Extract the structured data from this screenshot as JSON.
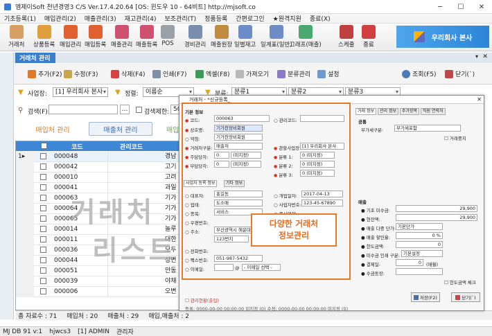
{
  "window": {
    "title": "엠제이Soft 천년경영3 C/S  Ver.17.4.20.64   [OS: 윈도우 10 - 64비트]   http://mjsoft.co"
  },
  "menu": [
    "기초등록(1)",
    "매입관리(2)",
    "매출관리(3)",
    "재고관리(4)",
    "보조관리(T)",
    "정품등록",
    "간편로그인",
    "★원격지원",
    "종료(X)"
  ],
  "toolbar": [
    {
      "label": "거래처",
      "color": "#d9a066"
    },
    {
      "label": "상품등록",
      "color": "#e0a040"
    },
    {
      "label": "매입관리",
      "color": "#e06030"
    },
    {
      "label": "매입등록",
      "color": "#e06030"
    },
    {
      "label": "매출관리",
      "color": "#d05070"
    },
    {
      "label": "매출등록",
      "color": "#d05070"
    },
    {
      "label": "POS",
      "color": "#9aa0a8"
    },
    {
      "label": "경비관리",
      "color": "#7a8fb0"
    },
    {
      "label": "매출원장",
      "color": "#c08a40"
    },
    {
      "label": "일별재고",
      "color": "#6d8cc8"
    },
    {
      "label": "일계표(일반)",
      "color": "#6d8cc8"
    },
    {
      "label": "그래프(매출)",
      "color": "#4aa870"
    },
    {
      "label": "스케줄",
      "color": "#c04040"
    },
    {
      "label": "종료",
      "color": "#d04040"
    }
  ],
  "brand": {
    "label": "우리회사 본사"
  },
  "doc_tab": {
    "label": "거래처 관리"
  },
  "subtoolbar": {
    "add": "추가(F2)",
    "edit": "수정(F3)",
    "delete": "삭제(F4)",
    "print": "인쇄(F7)",
    "excel": "엑셀(F8)",
    "import": "가져오기",
    "category": "분류관리",
    "settings": "설정",
    "search": "조회(F5)",
    "close": "닫기(`)"
  },
  "filters": {
    "branch_label": "사업장:",
    "branch_value": "[1] 우리회사 본사",
    "sort_label": "정렬:",
    "sort_value": "이름순",
    "cat_label": "분류:",
    "cat1": "분류1",
    "cat2": "분류2",
    "cat3": "분류3",
    "search_label": "검색(F):",
    "search_limit_label": "검색제한:",
    "search_limit_value": "50"
  },
  "modes": {
    "purchase": "매입처 관리",
    "sales": "매출처 관리",
    "third": "매입"
  },
  "grid": {
    "headers": {
      "code": "코드",
      "mgmt": "관리코드"
    },
    "rows": [
      {
        "code": "000048",
        "name": "경남"
      },
      {
        "code": "000042",
        "name": "고기"
      },
      {
        "code": "000010",
        "name": "고려"
      },
      {
        "code": "000041",
        "name": "과일"
      },
      {
        "code": "000063",
        "name": "기가"
      },
      {
        "code": "000064",
        "name": "기가"
      },
      {
        "code": "000065",
        "name": "기가"
      },
      {
        "code": "000014",
        "name": "놀루"
      },
      {
        "code": "000011",
        "name": "대한"
      },
      {
        "code": "000036",
        "name": "모두"
      },
      {
        "code": "000044",
        "name": "상변"
      },
      {
        "code": "000051",
        "name": "안동"
      },
      {
        "code": "000039",
        "name": "야채"
      },
      {
        "code": "000006",
        "name": "오변"
      }
    ],
    "first_marker": "1▸",
    "watermark_line1": "거래처",
    "watermark_line2": "리스트"
  },
  "status": {
    "total": "총 자료수 : 71",
    "purchase": "매입처 : 20",
    "sales": "매출처 : 29",
    "both": "매입,매출처 : 2"
  },
  "bottom_status": {
    "db": "MJ DB 91 v:1",
    "user": "hjwcs3",
    "role": "[1] ADMIN",
    "grade": "관리자"
  },
  "dialog": {
    "title": "거래처 - *신규등록_",
    "basic_section": "기본 정보",
    "code_label": "코드:",
    "code_value": "000063",
    "mgmt_label": "관리코드:",
    "name_label": "상호명:",
    "name_value": "기가찬장비회원",
    "alias_label": "약칭:",
    "alias_value": "기가찬장비회원",
    "type_label": "거래처구분:",
    "type_value": "매출처",
    "branch_label": "관할사업장:",
    "branch_value": "[1] 우리회사 본사",
    "major_label": "주담당자:",
    "major_value": "0",
    "major_unit": "(미지정)",
    "minor_label": "부담당자:",
    "minor_value": "0",
    "minor_unit": "(미지정)",
    "c1_label": "분류 1:",
    "c2_label": "분류 2:",
    "c3_label": "분류 3:",
    "c_value": "0",
    "c_unit": "(미지정)",
    "tabs": [
      "사업자 등록 정보",
      "기타 정보"
    ],
    "rep_label": "대표자:",
    "rep_value": "홍길동",
    "open_label": "개업일자:",
    "open_value": "2017-04-13",
    "biz_label": "업태:",
    "biz_value": "도소매",
    "bizno_label": "사업자번호:",
    "bizno_value": "123-45-67890",
    "item_label": "종목:",
    "item_value": "서비스",
    "sub_label": "종사업장:",
    "zip_label": "우편번호:",
    "addr_label": "주소:",
    "addr_value": "부산광역시 해운대구",
    "addr2_value": "123번지",
    "tel_label": "전화번호:",
    "fax_label": "팩스번호:",
    "fax_value": "051-987-5432",
    "email_label": "이메일:",
    "email_domain": "- 이메일 선택 -",
    "bond_label": "관리현황(출입)",
    "footer": "등록: 0000-00-00 00:00:00   미지정 (0)   수정: 0000-00-00 00:00:00   미지정 (0)",
    "right_tabs": [
      "거래 정보",
      "관리 정보",
      "추가항목",
      "직원 연락처"
    ],
    "common_section": "공통",
    "vat_label": "부가세구분:",
    "vat_value": "부가세포함",
    "stop_label": "거래중지",
    "sales_section": "매출",
    "ar_label": "기초 미수금:",
    "ar_value": "29,900",
    "cur_label": "현잔액:",
    "cur_value": "29,900",
    "price_label": "매출 다중 단가:",
    "price_value": "기본단가",
    "disc_label": "매출 할인율:",
    "disc_value": "0 %",
    "limit_label": "한도금액:",
    "limit_value": "0",
    "print_label": "미수금 인쇄 구분:",
    "print_value": "기본설정",
    "pay_label": "결제일:",
    "pay_value": "0",
    "pay_unit": "(매월)",
    "fee_label": "수금동장:",
    "limit_check": "한도금액 체크",
    "save": "저장(F2)",
    "close": "닫기(`)"
  },
  "callout": {
    "line1": "다양한 거래처",
    "line2": "정보관리"
  }
}
